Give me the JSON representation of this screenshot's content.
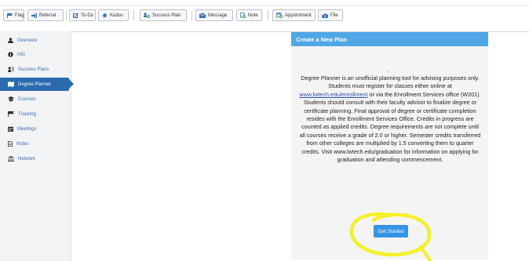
{
  "toolbar": {
    "flag": "Flag",
    "referral": "Referral",
    "todos": "To-Do",
    "kudos": "Kudos",
    "success_plan": "Success Plan",
    "message": "Message",
    "note": "Note",
    "appointment": "Appointment",
    "file": "File"
  },
  "sidebar": {
    "items": [
      {
        "label": "Overview",
        "icon": "user-icon"
      },
      {
        "label": "Info",
        "icon": "info-icon"
      },
      {
        "label": "Success Plans",
        "icon": "success-plans-icon"
      },
      {
        "label": "Degree Planner",
        "icon": "map-icon",
        "active": true
      },
      {
        "label": "Courses",
        "icon": "graduation-cap-icon"
      },
      {
        "label": "Tracking",
        "icon": "flag-icon"
      },
      {
        "label": "Meetings",
        "icon": "calendar-icon"
      },
      {
        "label": "Notes",
        "icon": "document-icon"
      },
      {
        "label": "Network",
        "icon": "bank-icon"
      }
    ]
  },
  "panel": {
    "title": "Create a New Plan",
    "dot": ".",
    "text_before_link": "Degree Planner is an unofficial planning tool for advising purposes only. Students must register for classes either online at ",
    "link_text": "www.lwtech.edu/enrollment",
    "text_after_link": " or via the Enrollment Services office (W201). Students should consult with their faculty advisor to finalize degree or certificate planning. Final approval of degree or certificate completion resides with the Enrollment Services Office. Credits in progress are counted as applied credits. Degree requirements are not complete until all courses receive a grade of 2.0 or higher. Semester credits transferred from other colleges are multiplied by 1.5 converting them to quarter credits. Visit www.lwtech.edu/graduation for information on applying for graduation and attending commencement.",
    "button_label": "Get Started"
  },
  "colors": {
    "accent": "#2a6aad",
    "panel_header": "#50a7e6",
    "button": "#3594e6",
    "highlight": "#f3f02a"
  }
}
